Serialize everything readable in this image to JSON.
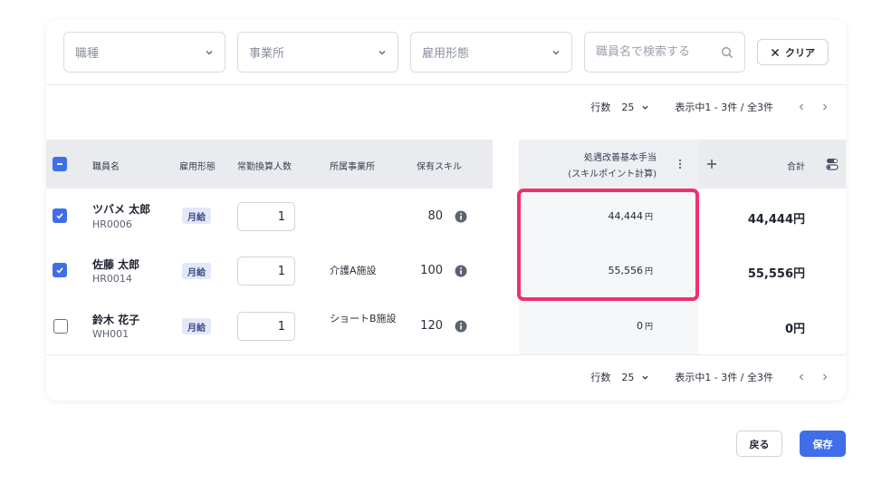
{
  "filters": {
    "job_type": "職種",
    "office": "事業所",
    "employment_type": "雇用形態",
    "search_placeholder": "職員名で検索する",
    "clear_label": "クリア"
  },
  "pagination": {
    "rows_label": "行数",
    "rows_value": "25",
    "info": "表示中1 - 3件 / 全3件"
  },
  "table": {
    "headers": {
      "name": "職員名",
      "employment": "雇用形態",
      "fte": "常勤換算人数",
      "office": "所属事業所",
      "skill": "保有スキル",
      "allowance_line1": "処遇改善基本手当",
      "allowance_line2": "(スキルポイント計算)",
      "total": "合計"
    },
    "rows": [
      {
        "checked": true,
        "name": "ツバメ 太郎",
        "code": "HR0006",
        "employment": "月給",
        "fte": "1",
        "office": "",
        "skill": "80",
        "allowance": "44,444",
        "unit": "円",
        "total": "44,444円"
      },
      {
        "checked": true,
        "name": "佐藤 太郎",
        "code": "HR0014",
        "employment": "月給",
        "fte": "1",
        "office": "介護A施設",
        "skill": "100",
        "allowance": "55,556",
        "unit": "円",
        "total": "55,556円"
      },
      {
        "checked": false,
        "name": "鈴木 花子",
        "code": "WH001",
        "employment": "月給",
        "fte": "1",
        "office": "ショートB施設",
        "skill": "120",
        "allowance": "0",
        "unit": "円",
        "total": "0円"
      }
    ]
  },
  "actions": {
    "back_label": "戻る",
    "save_label": "保存"
  },
  "colors": {
    "accent": "#3f6ee8",
    "highlight": "#f0306b"
  }
}
